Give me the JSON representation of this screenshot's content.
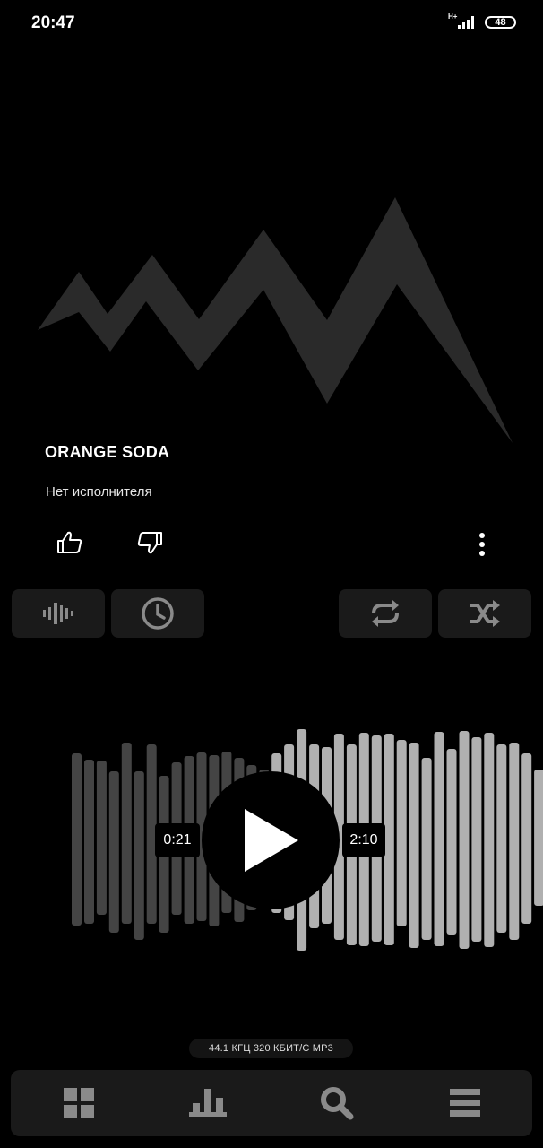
{
  "status_bar": {
    "time": "20:47",
    "network_type": "H+",
    "battery_level": "48"
  },
  "track": {
    "title": "ORANGE SODA",
    "artist": "Нет исполнителя"
  },
  "actions": {
    "like_icon": "thumbs-up-icon",
    "dislike_icon": "thumbs-down-icon",
    "more_icon": "more-vertical-icon"
  },
  "controls": [
    {
      "name": "visualizer-button",
      "icon": "waveform-icon"
    },
    {
      "name": "sleep-timer-button",
      "icon": "clock-icon"
    },
    {
      "name": "repeat-button",
      "icon": "repeat-icon"
    },
    {
      "name": "shuffle-button",
      "icon": "shuffle-icon"
    }
  ],
  "playback": {
    "elapsed": "0:21",
    "duration": "2:10",
    "progress_fraction": 0.16,
    "state": "paused"
  },
  "format_info": "44.1 КГЦ  320 КБИТ/С  MP3",
  "bottom_nav": [
    {
      "name": "nav-library",
      "icon": "grid-icon"
    },
    {
      "name": "nav-charts",
      "icon": "bar-chart-icon"
    },
    {
      "name": "nav-search",
      "icon": "search-icon"
    },
    {
      "name": "nav-menu",
      "icon": "menu-icon"
    }
  ],
  "colors": {
    "background": "#000000",
    "panel": "#1a1a1a",
    "art_shape": "#2a2a2a",
    "wave_played": "#444444",
    "wave_unplayed": "#b0b0b0",
    "icon": "#9a9a9a"
  }
}
